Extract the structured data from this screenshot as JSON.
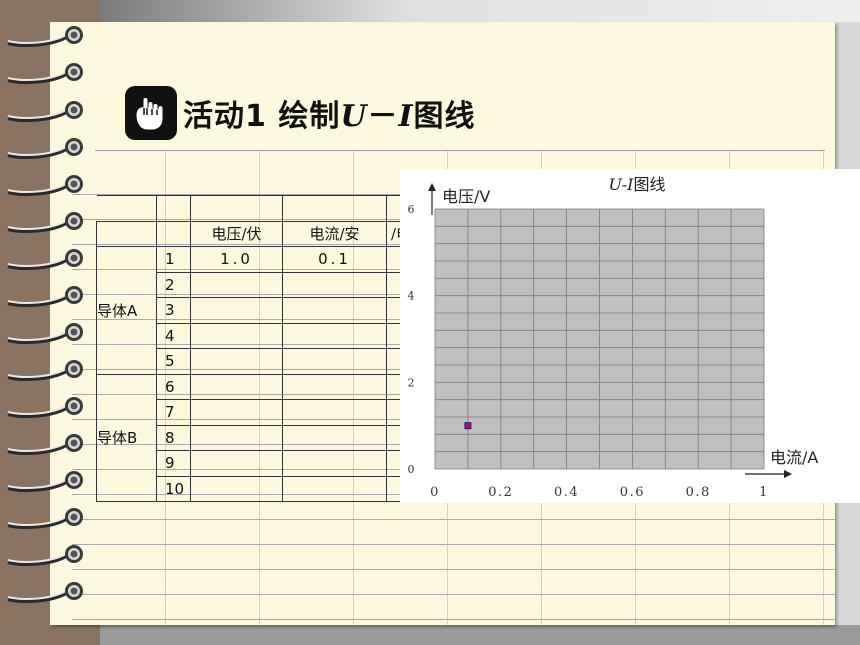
{
  "title": {
    "prefix": "活动1  绘制",
    "var_u": "U",
    "dash": "－",
    "var_i": "I",
    "suffix": "图线",
    "icon": "hand-pointing-icon"
  },
  "table": {
    "headers": [
      "电压/伏",
      "电流/安",
      "/电"
    ],
    "groups": [
      {
        "label": "导体A",
        "rows": [
          {
            "n": "1",
            "voltage": "1.0",
            "current": "0.1"
          },
          {
            "n": "2",
            "voltage": "",
            "current": ""
          },
          {
            "n": "3",
            "voltage": "",
            "current": ""
          },
          {
            "n": "4",
            "voltage": "",
            "current": ""
          },
          {
            "n": "5",
            "voltage": "",
            "current": ""
          }
        ]
      },
      {
        "label": "导体B",
        "rows": [
          {
            "n": "6",
            "voltage": "",
            "current": ""
          },
          {
            "n": "7",
            "voltage": "",
            "current": ""
          },
          {
            "n": "8",
            "voltage": "",
            "current": ""
          },
          {
            "n": "9",
            "voltage": "",
            "current": ""
          },
          {
            "n": "10",
            "voltage": "",
            "current": ""
          }
        ]
      }
    ]
  },
  "chart_data": {
    "type": "scatter",
    "title_var": "U-I",
    "title_suffix": "图线",
    "ylabel": "电压/V",
    "xlabel": "电流/A",
    "xlim": [
      0,
      1
    ],
    "ylim": [
      0,
      6
    ],
    "x_ticks": [
      "0",
      "0.2",
      "0.4",
      "0.6",
      "0.8",
      "1"
    ],
    "y_ticks": [
      "0",
      "2",
      "4",
      "6"
    ],
    "points": [
      {
        "x": 0.1,
        "y": 1.0
      }
    ],
    "grid": true,
    "colors": {
      "plot_bg": "#c0c0c0",
      "grid": "#7a7a7a",
      "point_fill": "#d0004a",
      "point_stroke": "#1a1a8a"
    }
  }
}
